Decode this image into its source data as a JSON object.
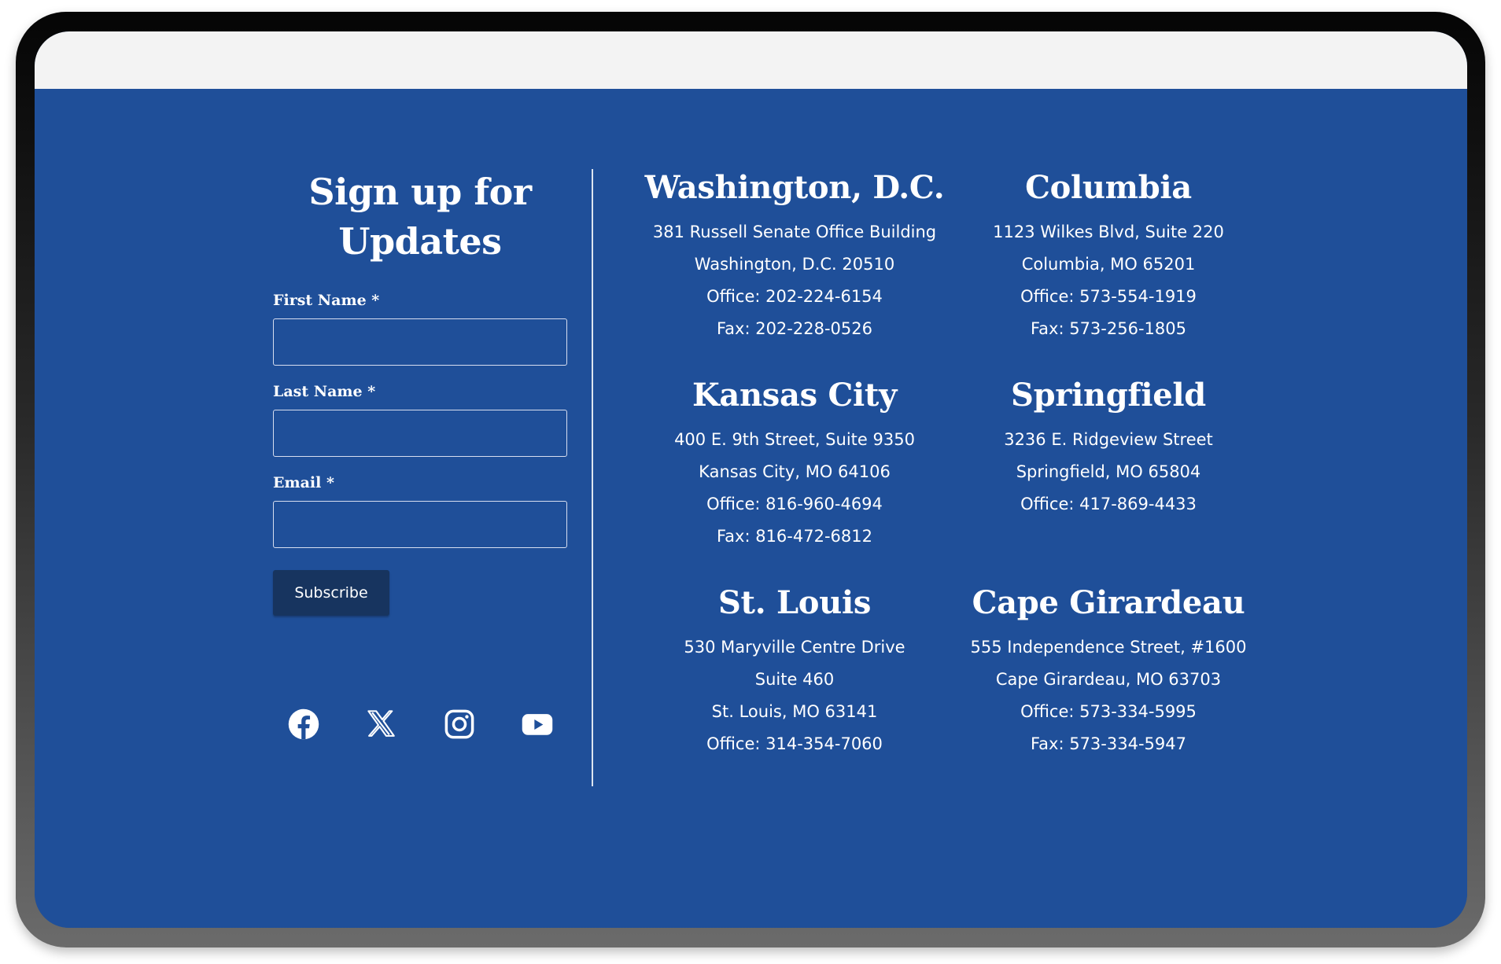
{
  "signup": {
    "title": "Sign up for Updates",
    "first_name_label": "First Name *",
    "last_name_label": "Last Name *",
    "email_label": "Email *",
    "first_name_value": "",
    "last_name_value": "",
    "email_value": "",
    "subscribe_label": "Subscribe"
  },
  "socials": [
    {
      "icon": "facebook-icon"
    },
    {
      "icon": "x-icon"
    },
    {
      "icon": "instagram-icon"
    },
    {
      "icon": "youtube-icon"
    }
  ],
  "offices": [
    {
      "name": "Washington, D.C.",
      "lines": [
        "381 Russell Senate Office Building",
        "Washington, D.C. 20510",
        "Office: 202-224-6154",
        "Fax: 202-228-0526"
      ]
    },
    {
      "name": "Columbia",
      "lines": [
        "1123 Wilkes Blvd, Suite 220",
        "Columbia, MO 65201",
        "Office: 573-554-1919",
        "Fax: 573-256-1805"
      ]
    },
    {
      "name": "Kansas City",
      "lines": [
        "400 E. 9th Street, Suite 9350",
        "Kansas City, MO 64106",
        "Office: 816-960-4694",
        "Fax: 816-472-6812"
      ]
    },
    {
      "name": "Springfield",
      "lines": [
        "3236 E. Ridgeview Street",
        "Springfield, MO 65804",
        "Office: 417-869-4433"
      ]
    },
    {
      "name": "St. Louis",
      "lines": [
        "530 Maryville Centre Drive",
        "Suite 460",
        "St. Louis, MO 63141",
        "Office: 314-354-7060"
      ]
    },
    {
      "name": "Cape Girardeau",
      "lines": [
        "555 Independence Street, #1600",
        "Cape Girardeau, MO 63703",
        "Office: 573-334-5995",
        "Fax: 573-334-5947"
      ]
    }
  ],
  "colors": {
    "footer_background": "#1f4f99",
    "button_background": "#17345f",
    "text": "#ffffff",
    "top_band": "#f3f3f3"
  }
}
